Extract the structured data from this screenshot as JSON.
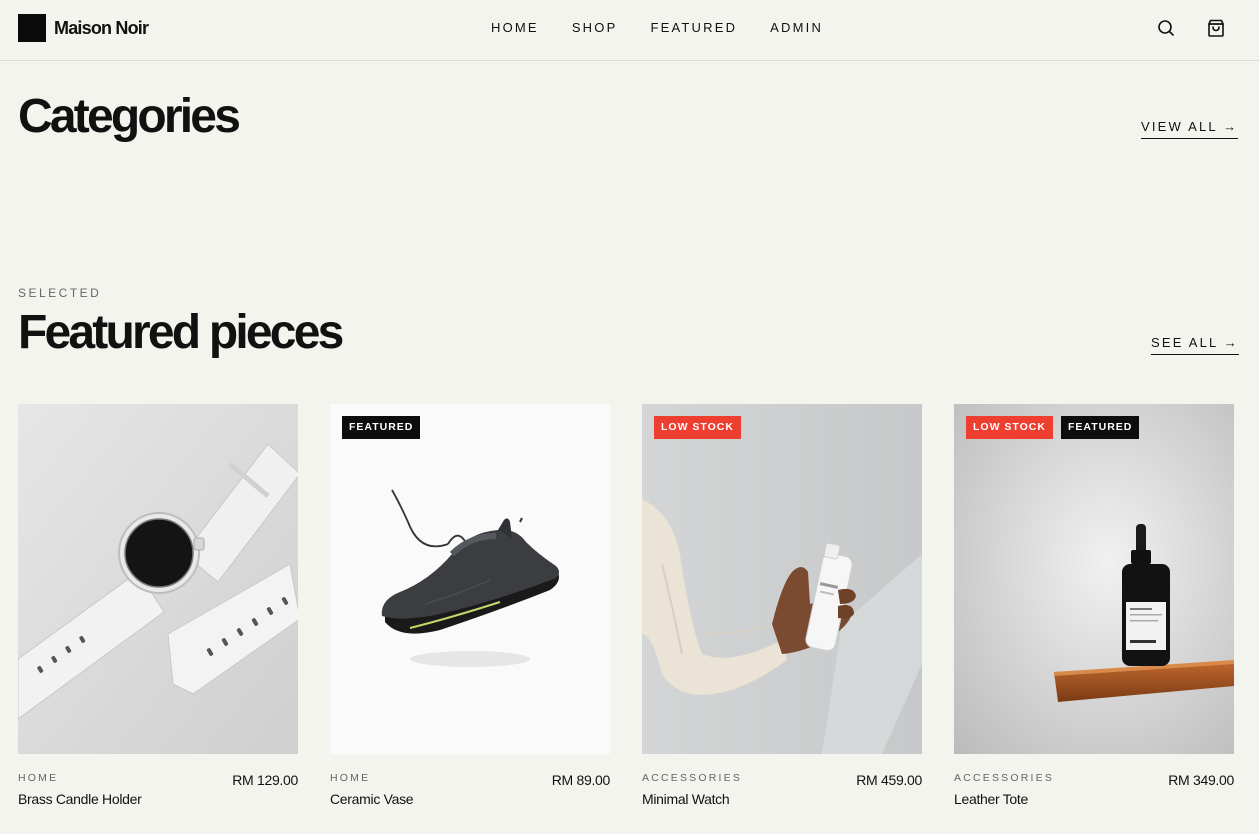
{
  "brand": {
    "name": "Maison Noir"
  },
  "nav": {
    "items": [
      {
        "label": "HOME"
      },
      {
        "label": "SHOP"
      },
      {
        "label": "FEATURED"
      },
      {
        "label": "ADMIN"
      }
    ]
  },
  "header_icons": {
    "search": "search-icon",
    "cart": "shopping-bag-icon"
  },
  "categories": {
    "title": "Categories",
    "view_all": "VIEW ALL →"
  },
  "featured": {
    "eyebrow": "SELECTED",
    "title": "Featured pieces",
    "see_all": "SEE ALL →",
    "products": [
      {
        "category": "HOME",
        "name": "Brass Candle Holder",
        "price": "RM 129.00",
        "badges": [],
        "image": "smartwatch-photo"
      },
      {
        "category": "HOME",
        "name": "Ceramic Vase",
        "price": "RM 89.00",
        "badges": [
          "FEATURED"
        ],
        "image": "sneaker-photo"
      },
      {
        "category": "ACCESSORIES",
        "name": "Minimal Watch",
        "price": "RM 459.00",
        "badges": [
          "LOW STOCK"
        ],
        "image": "hand-holding-bottle-photo"
      },
      {
        "category": "ACCESSORIES",
        "name": "Leather Tote",
        "price": "RM 349.00",
        "badges": [
          "LOW STOCK",
          "FEATURED"
        ],
        "image": "serum-bottle-photo"
      }
    ]
  },
  "colors": {
    "background": "#f4f4ef",
    "text": "#111111",
    "low_stock": "#ee3e2f",
    "featured": "#0d0d0d"
  }
}
